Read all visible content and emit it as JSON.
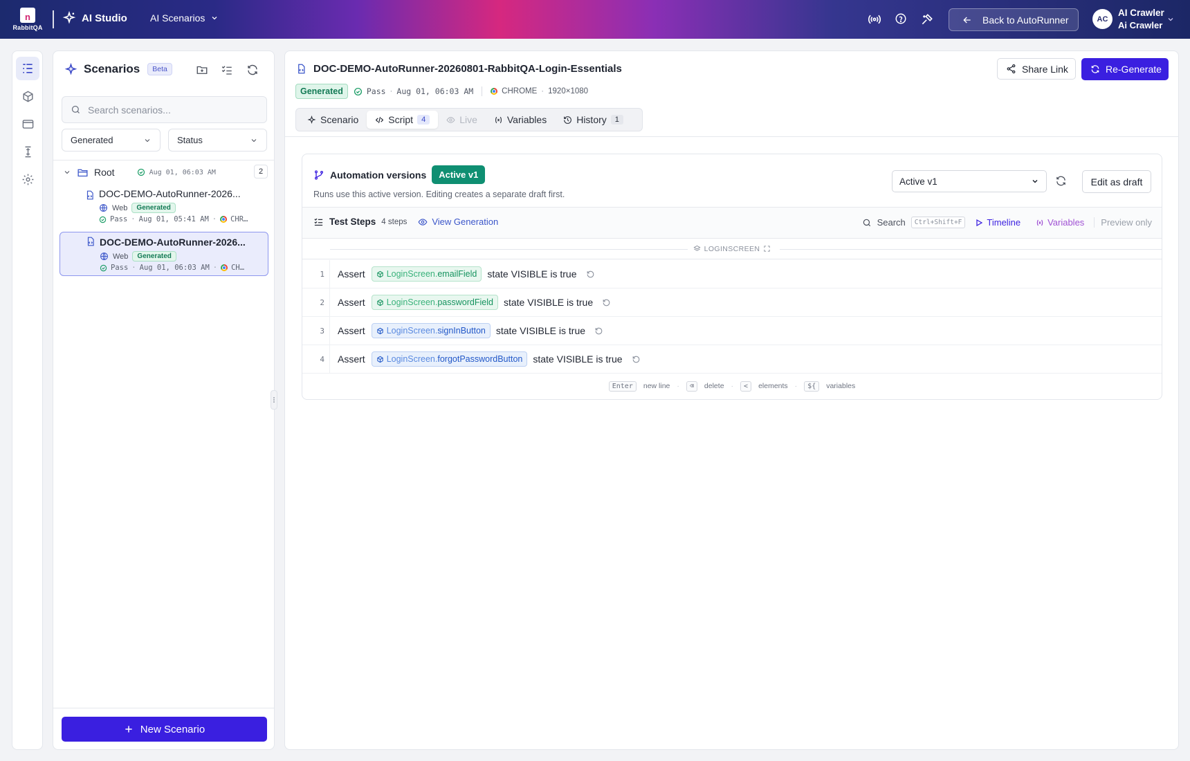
{
  "brand": {
    "logo_glyph": "n",
    "logo_text": "RabbitQA",
    "app": "AI Studio"
  },
  "header": {
    "section_menu": "AI Scenarios",
    "back_button": "Back to AutoRunner",
    "user": {
      "initials": "AC",
      "name": "AI Crawler",
      "org": "Ai Crawler"
    },
    "icons": [
      "broadcast-icon",
      "help-icon",
      "tools-icon"
    ]
  },
  "rail": {
    "items": [
      "scenarios-list-icon",
      "cube-icon",
      "browser-icon",
      "agent-icon",
      "settings-icon"
    ]
  },
  "sidebar": {
    "title": "Scenarios",
    "badge": "Beta",
    "search_placeholder": "Search scenarios...",
    "filter_type": "Generated",
    "filter_status": "Status",
    "root": {
      "name": "Root",
      "timestamp": "Aug 01, 06:03 AM",
      "count": "2"
    },
    "items": [
      {
        "title": "DOC-DEMO-AutoRunner-2026...",
        "platform": "Web",
        "badge": "Generated",
        "status": "Pass",
        "time": "Aug 01, 05:41 AM",
        "browser": "CHR…"
      },
      {
        "title": "DOC-DEMO-AutoRunner-2026...",
        "platform": "Web",
        "badge": "Generated",
        "status": "Pass",
        "time": "Aug 01, 06:03 AM",
        "browser": "CH…"
      }
    ],
    "new_button": "New Scenario"
  },
  "main": {
    "title": "DOC-DEMO-AutoRunner-20260801-RabbitQA-Login-Essentials",
    "badge": "Generated",
    "status": "Pass",
    "time": "Aug 01, 06:03 AM",
    "browser": "CHROME",
    "resolution": "1920×1080",
    "share_label": "Share Link",
    "regen_label": "Re-Generate",
    "tabs": [
      {
        "label": "Scenario",
        "count": ""
      },
      {
        "label": "Script",
        "count": "4"
      },
      {
        "label": "Live",
        "count": ""
      },
      {
        "label": "Variables",
        "count": ""
      },
      {
        "label": "History",
        "count": "1"
      }
    ]
  },
  "automation": {
    "title": "Automation versions",
    "active_badge": "Active v1",
    "subtitle": "Runs use this active version. Editing creates a separate draft first.",
    "version_select": "Active v1",
    "edit_draft": "Edit as draft"
  },
  "steps_bar": {
    "title": "Test Steps",
    "count": "4 steps",
    "view_generation": "View Generation",
    "search": "Search",
    "shortcut": "Ctrl+Shift+F",
    "timeline": "Timeline",
    "variables": "Variables",
    "preview": "Preview only"
  },
  "screen_label": "LOGINSCREEN",
  "steps": [
    {
      "n": "1",
      "kw": "Assert",
      "prefix": "LoginScreen.",
      "el": "emailField",
      "rest": "state VISIBLE is true",
      "color": "#16935f"
    },
    {
      "n": "2",
      "kw": "Assert",
      "prefix": "LoginScreen.",
      "el": "passwordField",
      "rest": "state VISIBLE is true",
      "color": "#16935f"
    },
    {
      "n": "3",
      "kw": "Assert",
      "prefix": "LoginScreen.",
      "el": "signInButton",
      "rest": "state VISIBLE is true",
      "color": "#2258c8"
    },
    {
      "n": "4",
      "kw": "Assert",
      "prefix": "LoginScreen.",
      "el": "forgotPasswordButton",
      "rest": "state VISIBLE is true",
      "color": "#2258c8"
    }
  ],
  "footer_hints": [
    {
      "key": "Enter",
      "label": "new line"
    },
    {
      "key": "⌫",
      "label": "delete"
    },
    {
      "key": "<",
      "label": "elements"
    },
    {
      "key": "${",
      "label": "variables"
    }
  ],
  "colors": {
    "accent": "#3a1fe0",
    "success": "#0f8f72",
    "brand_pink": "#d6287f"
  }
}
